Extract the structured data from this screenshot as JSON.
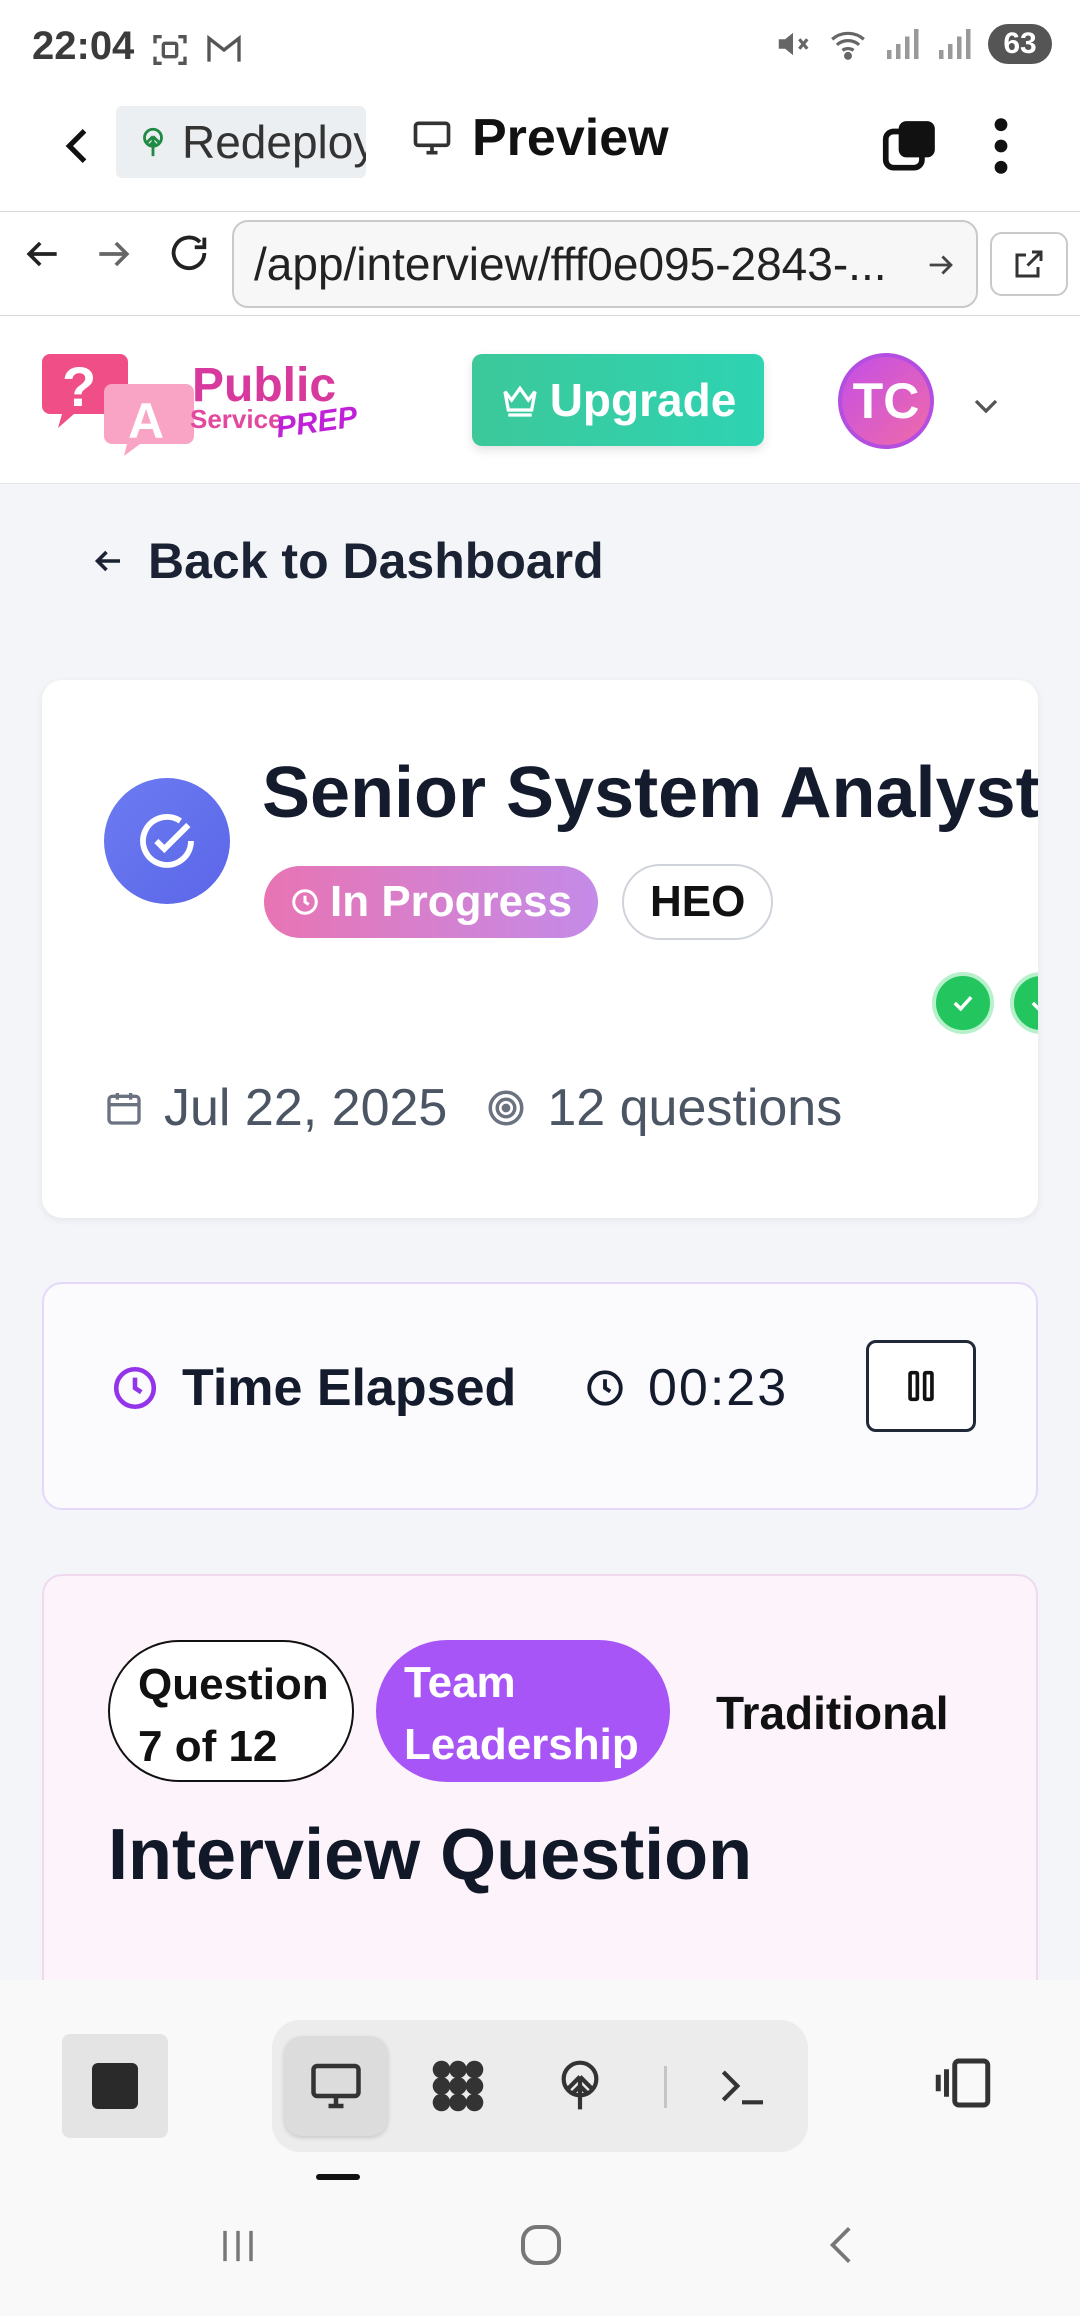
{
  "status_bar": {
    "time": "22:04",
    "battery": "63"
  },
  "browser": {
    "project_tab_label": "Redeploy",
    "preview_label": "Preview",
    "url": "/app/interview/fff0e095-2843-..."
  },
  "header": {
    "logo": {
      "line1": "Public",
      "line2": "Service",
      "line3": "PREP",
      "mark": "?A"
    },
    "upgrade_label": "Upgrade",
    "avatar_initials": "TC"
  },
  "back_link": "Back to Dashboard",
  "interview": {
    "title": "Senior System Analyst",
    "status": "In Progress",
    "level": "HEO",
    "date": "Jul 22, 2025",
    "questions_count": "12 questions"
  },
  "timer": {
    "label": "Time Elapsed",
    "value": "00:23"
  },
  "question": {
    "position_line1": "Question",
    "position_line2": "7 of 12",
    "category_line1": "Team",
    "category_line2": "Leadership",
    "type": "Traditional",
    "heading": "Interview Question"
  },
  "colors": {
    "accent_green": "#2ed3b2",
    "accent_purple": "#a855f7",
    "accent_pink": "#e874b3",
    "icon_blue": "#5b66e8"
  }
}
